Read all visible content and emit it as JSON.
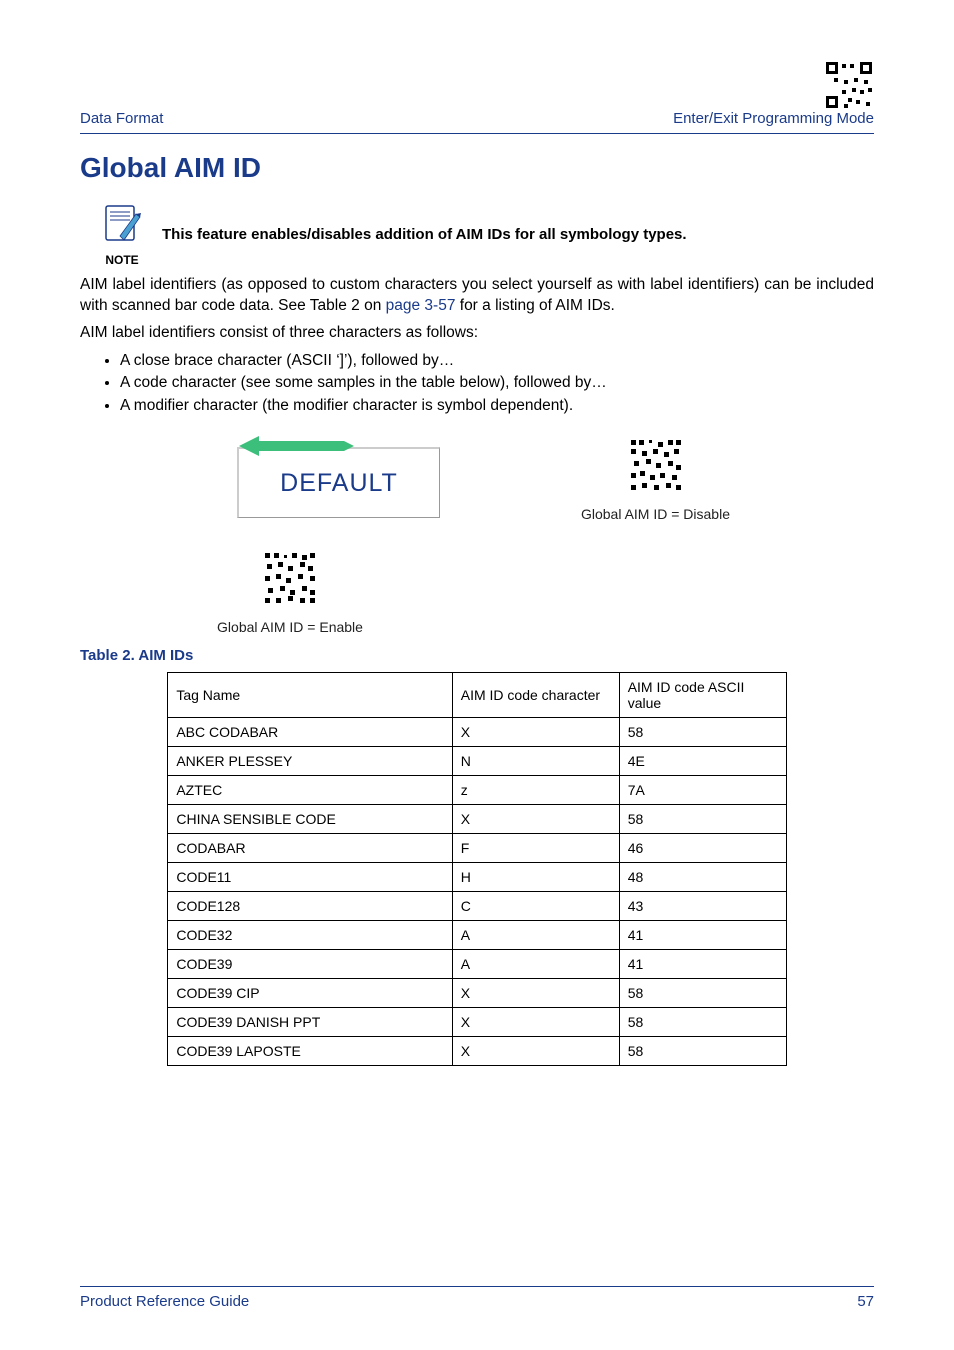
{
  "header": {
    "left": "Data Format",
    "right": "Enter/Exit Programming Mode"
  },
  "title": "Global AIM ID",
  "note": {
    "label": "NOTE",
    "text": "This feature enables/disables addition of AIM IDs for all symbology types."
  },
  "paragraph1_pre": "AIM label identifiers (as opposed to custom characters you select yourself as with label identifiers) can be included with scanned bar code data. See Table 2 on ",
  "page_ref": "page 3-57",
  "paragraph1_post": " for a listing of AIM IDs.",
  "paragraph2": "AIM label identifiers consist of three characters as follows:",
  "bullets": [
    "A close brace character (ASCII ‘]’), followed by…",
    "A code character (see some samples in the table below), followed by…",
    "A modifier character (the modifier character is symbol dependent)."
  ],
  "default_label": "DEFAULT",
  "barcode_caption_disable": "Global AIM ID = Disable",
  "barcode_caption_enable": "Global AIM ID = Enable",
  "table_label": "Table 2",
  "table_name": ".  AIM IDs",
  "table_headers": [
    "Tag Name",
    "AIM ID code character",
    "AIM ID code ASCII value"
  ],
  "table_rows": [
    [
      "ABC CODABAR",
      "X",
      "58"
    ],
    [
      "ANKER PLESSEY",
      "N",
      "4E"
    ],
    [
      "AZTEC",
      "z",
      "7A"
    ],
    [
      "CHINA SENSIBLE CODE",
      "X",
      "58"
    ],
    [
      "CODABAR",
      "F",
      "46"
    ],
    [
      "CODE11",
      "H",
      "48"
    ],
    [
      "CODE128",
      "C",
      "43"
    ],
    [
      "CODE32",
      "A",
      "41"
    ],
    [
      "CODE39",
      "A",
      "41"
    ],
    [
      "CODE39 CIP",
      "X",
      "58"
    ],
    [
      "CODE39 DANISH PPT",
      "X",
      "58"
    ],
    [
      "CODE39 LAPOSTE",
      "X",
      "58"
    ]
  ],
  "footer": {
    "left": "Product Reference Guide",
    "right": "57"
  }
}
